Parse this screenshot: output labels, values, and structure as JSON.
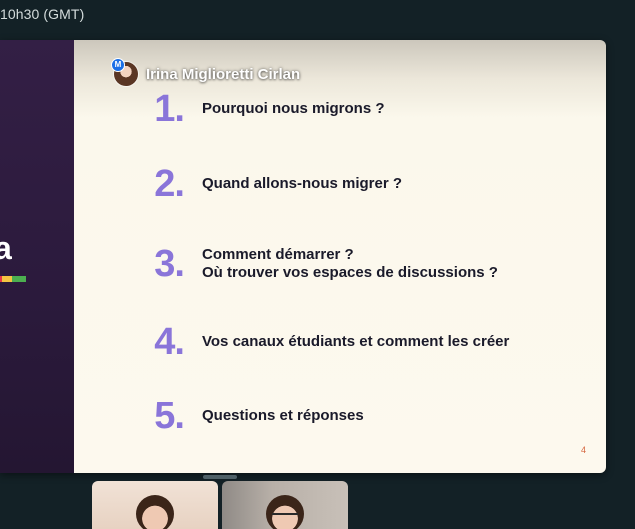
{
  "header": {
    "time_text": "10h30 (GMT)"
  },
  "sidebar_slide": {
    "partial_text": "a"
  },
  "presenter": {
    "name": "Irina Miglioretti Cirlan",
    "badge": "M"
  },
  "slide": {
    "items": [
      {
        "number": "1.",
        "lines": [
          "Pourquoi nous migrons ?"
        ]
      },
      {
        "number": "2.",
        "lines": [
          "Quand allons-nous migrer ?"
        ]
      },
      {
        "number": "3.",
        "lines": [
          "Comment démarrer ?",
          "Où trouver vos espaces de discussions ?"
        ]
      },
      {
        "number": "4.",
        "lines": [
          "Vos canaux étudiants et comment les créer"
        ]
      },
      {
        "number": "5.",
        "lines": [
          "Questions et réponses"
        ]
      }
    ],
    "page_number": "4"
  },
  "colors": {
    "number_accent": "#8a75d9",
    "strip": [
      "#e63946",
      "#f4c542",
      "#4caf50"
    ]
  }
}
